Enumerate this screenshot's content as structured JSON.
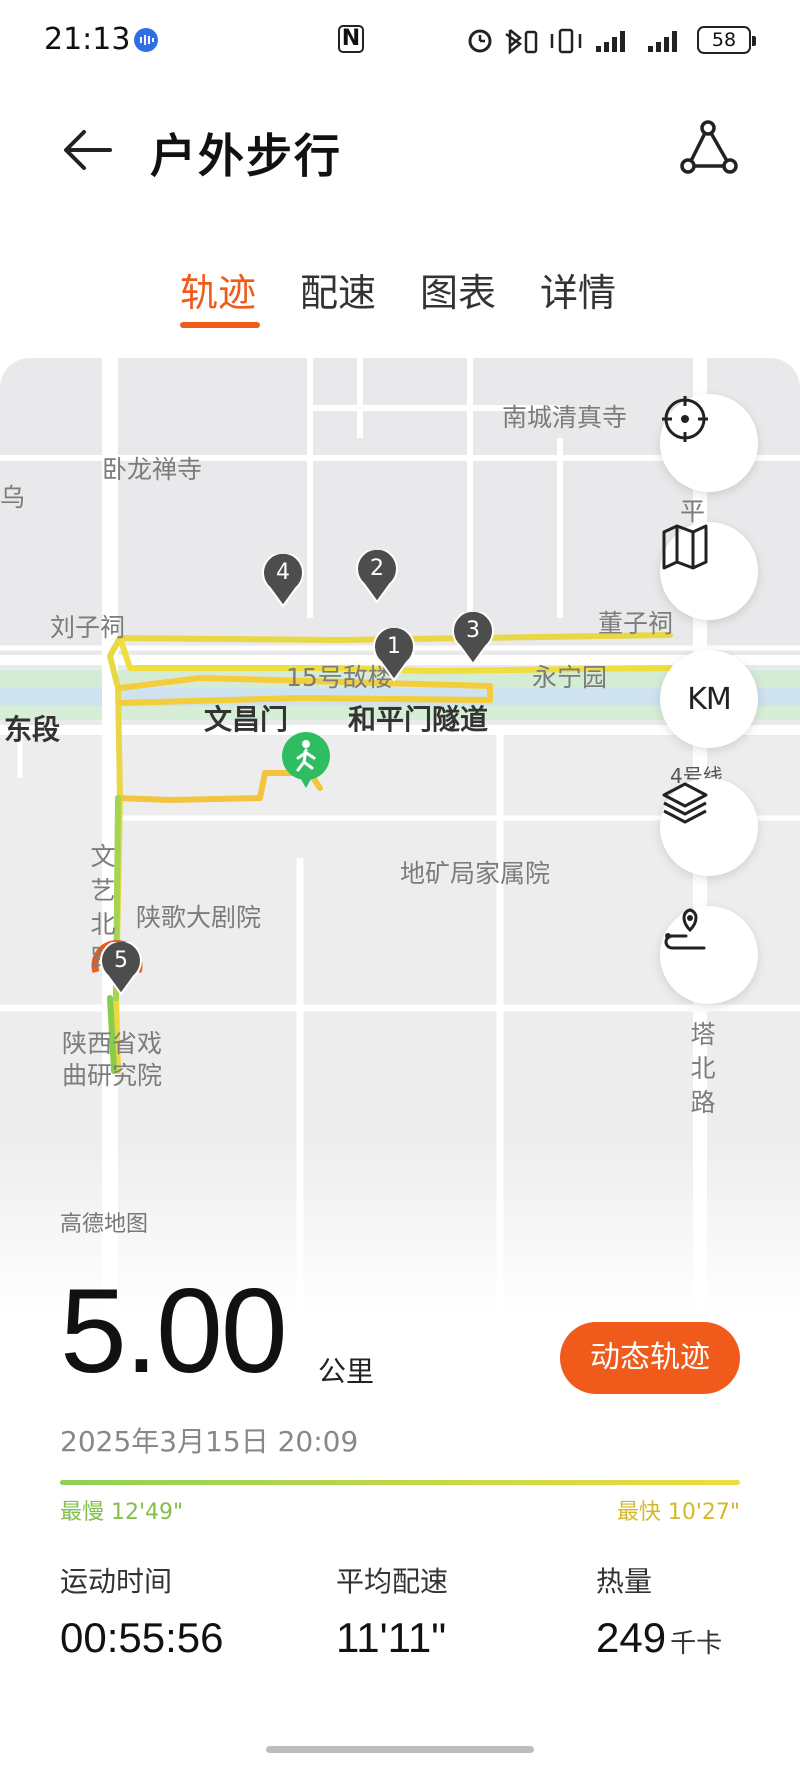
{
  "status_bar": {
    "time": "21:13",
    "battery": "58",
    "nfc": "N"
  },
  "header": {
    "title": "户外步行"
  },
  "tabs": [
    {
      "label": "轨迹",
      "active": true
    },
    {
      "label": "配速",
      "active": false
    },
    {
      "label": "图表",
      "active": false
    },
    {
      "label": "详情",
      "active": false
    }
  ],
  "map": {
    "labels": {
      "nancheng": "南城清真寺",
      "wolong": "卧龙禅寺",
      "wu": "乌",
      "ping": "平",
      "liuzici": "刘子祠",
      "dongzici": "董子祠",
      "dilou": "15号敌楼",
      "yongning": "永宁园",
      "dongduan": "东段",
      "wenchangmen": "文昌门",
      "heping_tunnel": "和平门隧道",
      "line4": "4号线",
      "dikuang": "地矿局家属院",
      "wenyi_road": "文艺北路",
      "shaange": "陕歌大剧院",
      "xiqu": "陕西省戏曲研究院",
      "tabei": "塔北路",
      "attribution": "高德地图"
    },
    "markers": [
      "1",
      "2",
      "3",
      "4",
      "5"
    ],
    "controls": {
      "km_label": "KM"
    },
    "accent": "#f05a1a"
  },
  "summary": {
    "distance": "5.00",
    "distance_unit": "公里",
    "dynamic_button": "动态轨迹",
    "date": "2025年3月15日 20:09",
    "slowest": "最慢 12'49\"",
    "fastest": "最快 10'27\"",
    "stats": [
      {
        "label": "运动时间",
        "value": "00:55:56",
        "unit": ""
      },
      {
        "label": "平均配速",
        "value": "11'11\"",
        "unit": ""
      },
      {
        "label": "热量",
        "value": "249",
        "unit": "千卡"
      }
    ]
  }
}
